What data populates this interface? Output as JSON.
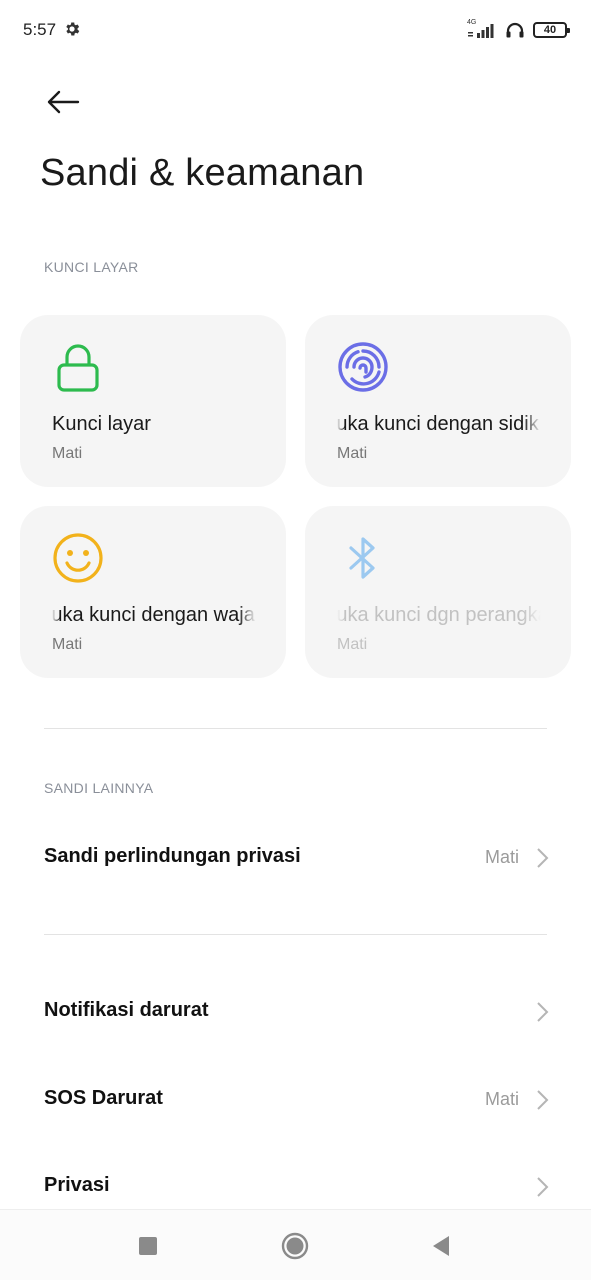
{
  "status_bar": {
    "time": "5:57",
    "network": "4G",
    "battery": "40",
    "icons": [
      "gear-icon",
      "signal-icon",
      "headphones-icon",
      "battery-icon"
    ]
  },
  "header": {
    "back_icon": "back-arrow-icon",
    "title": "Sandi & keamanan"
  },
  "screen_lock": {
    "section_label": "KUNCI LAYAR",
    "cards": [
      {
        "title": "Kunci layar",
        "status": "Mati",
        "icon": "lock-icon",
        "color": "#2dbb4e"
      },
      {
        "title": "Buka kunci dengan sidik jari",
        "status": "Mati",
        "icon": "fingerprint-icon",
        "color": "#6b6ee6"
      },
      {
        "title": "Buka kunci dengan wajah",
        "status": "Mati",
        "icon": "face-icon",
        "color": "#f2b21b"
      },
      {
        "title": "Buka kunci dgn perangkat Bluetooth",
        "status": "Mati",
        "icon": "bluetooth-icon",
        "color": "#9cc9f0",
        "disabled": true
      }
    ]
  },
  "other_passwords": {
    "section_label": "SANDI LAINNYA",
    "items": [
      {
        "label": "Sandi perlindungan privasi",
        "value": "Mati"
      }
    ]
  },
  "more": {
    "items": [
      {
        "label": "Notifikasi darurat",
        "value": ""
      },
      {
        "label": "SOS Darurat",
        "value": "Mati"
      },
      {
        "label": "Privasi",
        "value": ""
      }
    ]
  },
  "nav_bar": {
    "icons": [
      "recents-square-icon",
      "home-circle-icon",
      "back-triangle-icon"
    ]
  }
}
